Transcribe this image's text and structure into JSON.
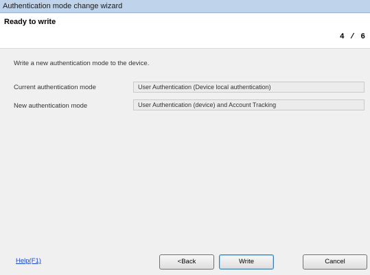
{
  "window": {
    "title": "Authentication mode change wizard"
  },
  "header": {
    "title": "Ready to write",
    "step": "4 / 6"
  },
  "main": {
    "intro": "Write a new authentication mode to the device.",
    "fields": [
      {
        "label": "Current authentication mode",
        "value": "User Authentication (Device local authentication)"
      },
      {
        "label": "New authentication mode",
        "value": "User Authentication (device) and Account Tracking"
      }
    ]
  },
  "footer": {
    "help": "Help(F1)",
    "back_label": "<Back",
    "write_label": "Write",
    "cancel_label": "Cancel"
  }
}
